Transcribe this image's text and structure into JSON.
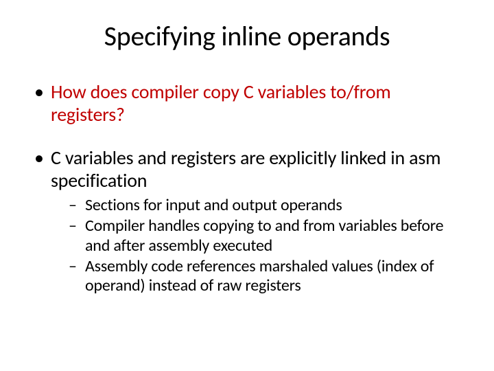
{
  "title": "Specifying inline operands",
  "bullets": [
    {
      "text": "How does compiler copy C variables to/from registers?",
      "style": "red",
      "sub": []
    },
    {
      "text": "C variables and registers are explicitly linked in asm specification",
      "style": "black",
      "sub": [
        "Sections for input and output operands",
        "Compiler handles copying to and from variables before and after assembly executed",
        "Assembly code references marshaled values (index of operand) instead of raw registers"
      ]
    }
  ]
}
